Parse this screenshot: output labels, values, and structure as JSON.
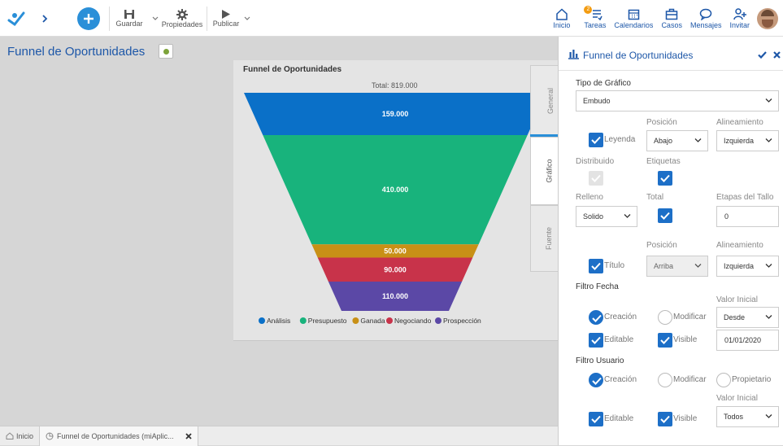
{
  "toolbar": {
    "guardar": "Guardar",
    "propiedades": "Propiedades",
    "publicar": "Publicar"
  },
  "nav": {
    "inicio": "Inicio",
    "tareas": "Tareas",
    "tareas_badge": "2",
    "calendarios": "Calendarios",
    "casos": "Casos",
    "mensajes": "Mensajes",
    "invitar": "Invitar"
  },
  "page": {
    "title": "Funnel de Oportunidades"
  },
  "chart_data": {
    "type": "funnel",
    "title": "Funnel de Oportunidades",
    "total_label": "Total: 819.000",
    "stages": [
      {
        "label": "159.000",
        "value": 159000,
        "color": "#0a70c8"
      },
      {
        "label": "410.000",
        "value": 410000,
        "color": "#18b37c"
      },
      {
        "label": "50.000",
        "value": 50000,
        "color": "#c89016"
      },
      {
        "label": "90.000",
        "value": 90000,
        "color": "#c8334a"
      },
      {
        "label": "110.000",
        "value": 110000,
        "color": "#5b48a6"
      }
    ],
    "legend": [
      {
        "name": "Análisis",
        "color": "#0a70c8"
      },
      {
        "name": "Presupuesto",
        "color": "#18b37c"
      },
      {
        "name": "Ganada",
        "color": "#c89016"
      },
      {
        "name": "Negociando",
        "color": "#c8334a"
      },
      {
        "name": "Prospección",
        "color": "#5b48a6"
      }
    ],
    "legend_position": "bottom"
  },
  "vtabs": {
    "general": "General",
    "grafico": "Gráfico",
    "fuente": "Fuente"
  },
  "bottom": {
    "inicio": "Inicio",
    "tab": "Funnel de Oportunidades (miAplic..."
  },
  "panel": {
    "title": "Funnel de Oportunidades",
    "tipo_label": "Tipo de Gráfico",
    "tipo_value": "Embudo",
    "posicion": "Posición",
    "alineamiento": "Alineamiento",
    "leyenda": "Leyenda",
    "leyenda_pos": "Abajo",
    "leyenda_align": "Izquierda",
    "distribuido": "Distribuido",
    "etiquetas": "Etiquetas",
    "relleno": "Relleno",
    "relleno_value": "Solido",
    "total": "Total",
    "etapas": "Etapas del Tallo",
    "etapas_value": "0",
    "posicion2": "Posición",
    "alineamiento2": "Alineamiento",
    "titulo": "Título",
    "titulo_pos": "Arriba",
    "titulo_align": "Izquierda",
    "filtro_fecha": "Filtro Fecha",
    "valor_inicial": "Valor Inicial",
    "creacion": "Creación",
    "modificar": "Modificar",
    "desde": "Desde",
    "editable": "Editable",
    "visible": "Visible",
    "fecha_value": "01/01/2020",
    "filtro_usuario": "Filtro Usuario",
    "creacion2": "Creación",
    "modificar2": "Modificar",
    "propietario": "Propietario",
    "valor_inicial2": "Valor Inicial",
    "editable2": "Editable",
    "visible2": "Visible",
    "todos": "Todos"
  }
}
